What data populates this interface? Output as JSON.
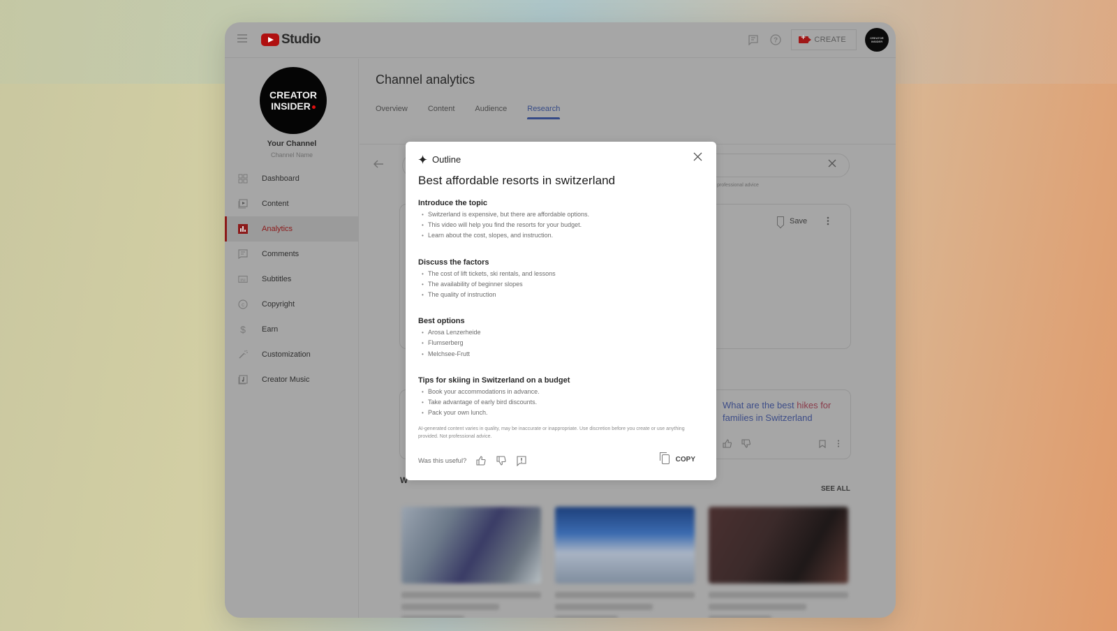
{
  "app": {
    "logo_text": "Studio",
    "create_label": "CREATE",
    "avatar_text": "CREATOR INSIDER"
  },
  "sidebar": {
    "avatar_line1": "CREATOR",
    "avatar_line2": "INSIDER",
    "channel_title": "Your Channel",
    "channel_name": "Channel Name",
    "items": [
      {
        "label": "Dashboard",
        "icon": "dashboard-icon",
        "active": false
      },
      {
        "label": "Content",
        "icon": "content-icon",
        "active": false
      },
      {
        "label": "Analytics",
        "icon": "analytics-icon",
        "active": true
      },
      {
        "label": "Comments",
        "icon": "comments-icon",
        "active": false
      },
      {
        "label": "Subtitles",
        "icon": "subtitles-icon",
        "active": false
      },
      {
        "label": "Copyright",
        "icon": "copyright-icon",
        "active": false
      },
      {
        "label": "Earn",
        "icon": "earn-icon",
        "active": false
      },
      {
        "label": "Customization",
        "icon": "customization-icon",
        "active": false
      },
      {
        "label": "Creator Music",
        "icon": "creator-music-icon",
        "active": false
      }
    ]
  },
  "main": {
    "page_title": "Channel analytics",
    "tabs": [
      {
        "label": "Overview",
        "active": false
      },
      {
        "label": "Content",
        "active": false
      },
      {
        "label": "Audience",
        "active": false
      },
      {
        "label": "Research",
        "active": true
      }
    ],
    "search_disclaimer_tail": "professional advice",
    "save_label": "Save",
    "idea_link_part1": "What are the best ",
    "idea_link_part2": "hikes for",
    "idea_link_part3": "families in Switzerland",
    "section_initial": "W",
    "see_all_label": "SEE ALL"
  },
  "dialog": {
    "header": "Outline",
    "title": "Best affordable resorts in switzerland",
    "sections": [
      {
        "heading": "Introduce the topic",
        "bullets": [
          "Switzerland is expensive, but there are affordable options.",
          "This video will help you find the resorts for your budget.",
          "Learn about the cost, slopes, and instruction."
        ]
      },
      {
        "heading": "Discuss the factors",
        "bullets": [
          "The cost of lift tickets, ski rentals, and lessons",
          "The availability of beginner slopes",
          "The quality of instruction"
        ]
      },
      {
        "heading": "Best options",
        "bullets": [
          "Arosa Lenzerheide",
          "Flumserberg",
          "Melchsee-Frutt"
        ]
      },
      {
        "heading": "Tips for skiing in Switzerland on a budget",
        "bullets": [
          "Book your accommodations in advance.",
          "Take advantage of early bird discounts.",
          "Pack your own lunch."
        ]
      }
    ],
    "ai_note": "AI-generated content varies in quality, may be inaccurate or inappropriate. Use discretion before you create or use anything provided. Not professional advice.",
    "feedback_label": "Was this useful?",
    "copy_label": "COPY"
  }
}
